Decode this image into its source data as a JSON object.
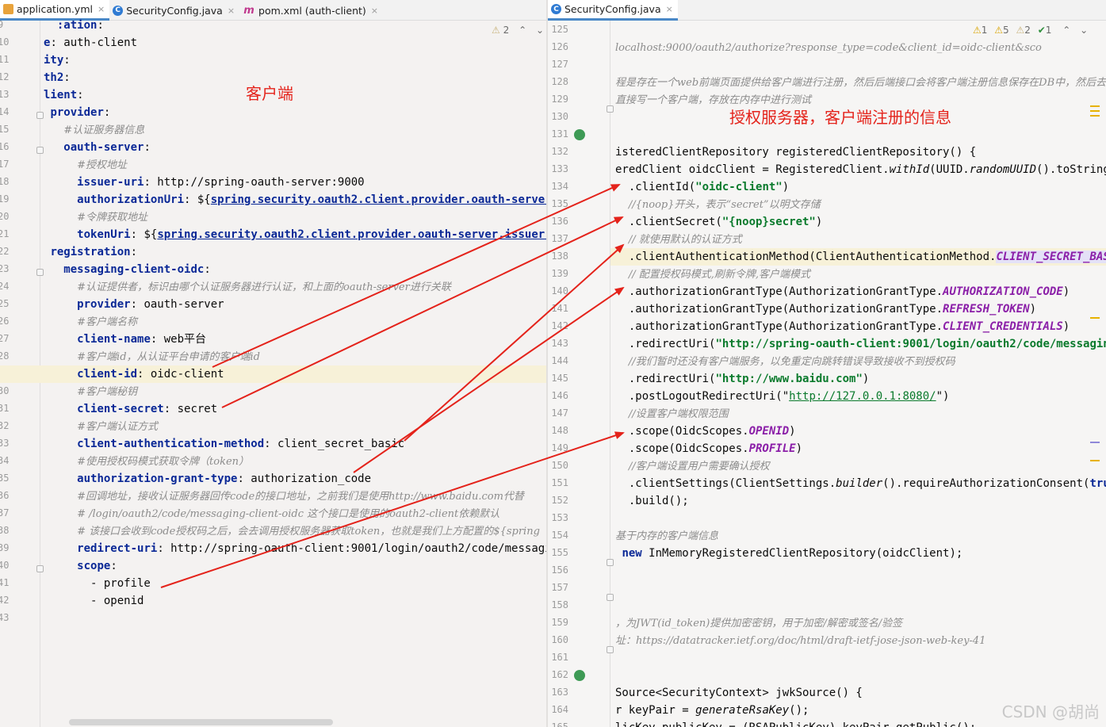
{
  "left_tabs": [
    {
      "label": "application.yml",
      "icon": "yml-file-icon"
    },
    {
      "label": "SecurityConfig.java",
      "icon": "java-class-icon"
    },
    {
      "label": "pom.xml (auth-client)",
      "icon": "maven-icon"
    }
  ],
  "right_tabs": [
    {
      "label": "SecurityConfig.java",
      "icon": "java-class-icon"
    }
  ],
  "tab_close_glyph": "×",
  "left_inspection": {
    "warnings": "2"
  },
  "right_inspection": {
    "warn1": "1",
    "warn2": "5",
    "warn3": "2",
    "ok": "1"
  },
  "annotations": {
    "client_label": "客户端",
    "server_label": "授权服务器，客户端注册的信息"
  },
  "watermark": "CSDN @胡尚",
  "arrow_color": "#e4231b",
  "left_lines": [
    {
      "n": "9",
      "parts": [
        [
          "",
          "  "
        ],
        [
          "k",
          ":ation"
        ],
        [
          "",
          ":"
        ]
      ]
    },
    {
      "n": "10",
      "parts": [
        [
          "k",
          "e"
        ],
        [
          "",
          ": auth-client"
        ]
      ]
    },
    {
      "n": "11",
      "parts": [
        [
          "k",
          "ity"
        ],
        [
          "",
          ":"
        ]
      ]
    },
    {
      "n": "12",
      "parts": [
        [
          "k",
          "th2"
        ],
        [
          "",
          ":"
        ]
      ]
    },
    {
      "n": "13",
      "parts": [
        [
          "k",
          "lient"
        ],
        [
          "",
          ":"
        ]
      ]
    },
    {
      "n": "14",
      "parts": [
        [
          "",
          " "
        ],
        [
          "k",
          "provider"
        ],
        [
          "",
          ":"
        ]
      ]
    },
    {
      "n": "15",
      "parts": [
        [
          "",
          "   "
        ],
        [
          "c",
          "#认证服务器信息"
        ]
      ]
    },
    {
      "n": "16",
      "parts": [
        [
          "",
          "   "
        ],
        [
          "k",
          "oauth-server"
        ],
        [
          "",
          ":"
        ]
      ]
    },
    {
      "n": "17",
      "parts": [
        [
          "",
          "     "
        ],
        [
          "c",
          "#授权地址"
        ]
      ]
    },
    {
      "n": "18",
      "parts": [
        [
          "",
          "     "
        ],
        [
          "k",
          "issuer-uri"
        ],
        [
          "",
          ": http://spring-oauth-server:9000"
        ]
      ]
    },
    {
      "n": "19",
      "parts": [
        [
          "",
          "     "
        ],
        [
          "k",
          "authorizationUri"
        ],
        [
          "",
          ": ${"
        ],
        [
          "ref",
          "spring.security.oauth2.client.provider.oauth-server.iss"
        ]
      ]
    },
    {
      "n": "20",
      "parts": [
        [
          "",
          "     "
        ],
        [
          "c",
          "#令牌获取地址"
        ]
      ]
    },
    {
      "n": "21",
      "parts": [
        [
          "",
          "     "
        ],
        [
          "k",
          "tokenUri"
        ],
        [
          "",
          ": ${"
        ],
        [
          "ref",
          "spring.security.oauth2.client.provider.oauth-server.issuer-uri"
        ],
        [
          "",
          "}"
        ]
      ]
    },
    {
      "n": "22",
      "parts": [
        [
          "",
          " "
        ],
        [
          "k",
          "registration"
        ],
        [
          "",
          ":"
        ]
      ]
    },
    {
      "n": "23",
      "parts": [
        [
          "",
          "   "
        ],
        [
          "k",
          "messaging-client-oidc"
        ],
        [
          "",
          ":"
        ]
      ]
    },
    {
      "n": "24",
      "parts": [
        [
          "",
          "     "
        ],
        [
          "c",
          "#认证提供者，标识由哪个认证服务器进行认证，和上面的oauth-server进行关联"
        ]
      ]
    },
    {
      "n": "25",
      "parts": [
        [
          "",
          "     "
        ],
        [
          "k",
          "provider"
        ],
        [
          "",
          ": oauth-server"
        ]
      ]
    },
    {
      "n": "26",
      "parts": [
        [
          "",
          "     "
        ],
        [
          "c",
          "#客户端名称"
        ]
      ]
    },
    {
      "n": "27",
      "parts": [
        [
          "",
          "     "
        ],
        [
          "k",
          "client-name"
        ],
        [
          "",
          ": web平台"
        ]
      ]
    },
    {
      "n": "28",
      "parts": [
        [
          "",
          "     "
        ],
        [
          "c",
          "#客户端id，从认证平台申请的客户端id"
        ]
      ]
    },
    {
      "n": "29",
      "parts": [
        [
          "",
          "     "
        ],
        [
          "k",
          "client-id"
        ],
        [
          "",
          ": oidc-client"
        ]
      ],
      "highlight": true
    },
    {
      "n": "30",
      "parts": [
        [
          "",
          "     "
        ],
        [
          "c",
          "#客户端秘钥"
        ]
      ]
    },
    {
      "n": "31",
      "parts": [
        [
          "",
          "     "
        ],
        [
          "k",
          "client-secret"
        ],
        [
          "",
          ": secret"
        ]
      ]
    },
    {
      "n": "32",
      "parts": [
        [
          "",
          "     "
        ],
        [
          "c",
          "#客户端认证方式"
        ]
      ]
    },
    {
      "n": "33",
      "parts": [
        [
          "",
          "     "
        ],
        [
          "k",
          "client-authentication-method"
        ],
        [
          "",
          ": client_secret_basic"
        ]
      ]
    },
    {
      "n": "34",
      "parts": [
        [
          "",
          "     "
        ],
        [
          "c",
          "#使用授权码模式获取令牌（token）"
        ]
      ]
    },
    {
      "n": "35",
      "parts": [
        [
          "",
          "     "
        ],
        [
          "k",
          "authorization-grant-type"
        ],
        [
          "",
          ": authorization_code"
        ]
      ]
    },
    {
      "n": "36",
      "parts": [
        [
          "",
          "     "
        ],
        [
          "c",
          "#回调地址，接收认证服务器回传code的接口地址，之前我们是使用http://www.baidu.com代替"
        ]
      ]
    },
    {
      "n": "37",
      "parts": [
        [
          "",
          "     "
        ],
        [
          "c",
          "# /login/oauth2/code/messaging-client-oidc 这个接口是使用的oauth2-client依赖默认"
        ]
      ]
    },
    {
      "n": "38",
      "parts": [
        [
          "",
          "     "
        ],
        [
          "c",
          "# 该接口会收到code授权码之后，会去调用授权服务器获取token，也就是我们上方配置的${spring"
        ]
      ]
    },
    {
      "n": "39",
      "parts": [
        [
          "",
          "     "
        ],
        [
          "k",
          "redirect-uri"
        ],
        [
          "",
          ": http://spring-oauth-client:9001/login/oauth2/code/messaging-c"
        ]
      ]
    },
    {
      "n": "40",
      "parts": [
        [
          "",
          "     "
        ],
        [
          "k",
          "scope"
        ],
        [
          "",
          ":"
        ]
      ]
    },
    {
      "n": "41",
      "parts": [
        [
          "",
          "       - profile"
        ]
      ]
    },
    {
      "n": "42",
      "parts": [
        [
          "",
          "       - openid"
        ]
      ]
    },
    {
      "n": "43",
      "parts": []
    }
  ],
  "right_lines": [
    {
      "n": "125",
      "parts": [
        [
          "c",
          "   "
        ]
      ]
    },
    {
      "n": "126",
      "parts": [
        [
          "c",
          "localhost:9000/oauth2/authorize?response_type=code&client_id=oidc-client&sco"
        ]
      ]
    },
    {
      "n": "127",
      "parts": []
    },
    {
      "n": "128",
      "parts": [
        [
          "c",
          "程是存在一个web前端页面提供给客户端进行注册，然后后端接口会将客户端注册信息保存在DB中，然后去"
        ]
      ]
    },
    {
      "n": "129",
      "parts": [
        [
          "c",
          "直接写一个客户端，存放在内存中进行测试"
        ]
      ]
    },
    {
      "n": "130",
      "parts": []
    },
    {
      "n": "131",
      "parts": [],
      "bean": true
    },
    {
      "n": "132",
      "parts": [
        [
          "",
          "isteredClientRepository registeredClientRepository() {"
        ]
      ]
    },
    {
      "n": "133",
      "parts": [
        [
          "",
          "eredClient oidcClient = RegisteredClient."
        ],
        [
          "it",
          "withId"
        ],
        [
          "",
          "(UUID."
        ],
        [
          "it",
          "randomUUID"
        ],
        [
          "",
          "().toString())"
        ]
      ]
    },
    {
      "n": "134",
      "parts": [
        [
          "",
          "  .clientId("
        ],
        [
          "s",
          "\"oidc-client\""
        ],
        [
          "",
          ")"
        ]
      ]
    },
    {
      "n": "135",
      "parts": [
        [
          "",
          "  "
        ],
        [
          "c",
          "//{noop}开头，表示“secret”以明文存储"
        ]
      ]
    },
    {
      "n": "136",
      "parts": [
        [
          "",
          "  .clientSecret("
        ],
        [
          "s",
          "\"{noop}secret\""
        ],
        [
          "",
          ")"
        ]
      ]
    },
    {
      "n": "137",
      "parts": [
        [
          "",
          "  "
        ],
        [
          "c",
          "// 就使用默认的认证方式"
        ]
      ]
    },
    {
      "n": "138",
      "parts": [
        [
          "",
          "  .clientAuthenticationMethod(ClientAuthenticationMethod."
        ],
        [
          "enum enum-hl",
          "CLIENT_SECRET_BASIC"
        ],
        [
          "",
          ")"
        ]
      ],
      "highlight": true
    },
    {
      "n": "139",
      "parts": [
        [
          "",
          "  "
        ],
        [
          "c",
          "// 配置授权码模式,刷新令牌,客户端模式"
        ]
      ]
    },
    {
      "n": "140",
      "parts": [
        [
          "",
          "  .authorizationGrantType(AuthorizationGrantType."
        ],
        [
          "enum",
          "AUTHORIZATION_CODE"
        ],
        [
          "",
          ")"
        ]
      ]
    },
    {
      "n": "141",
      "parts": [
        [
          "",
          "  .authorizationGrantType(AuthorizationGrantType."
        ],
        [
          "enum",
          "REFRESH_TOKEN"
        ],
        [
          "",
          ")"
        ]
      ]
    },
    {
      "n": "142",
      "parts": [
        [
          "",
          "  .authorizationGrantType(AuthorizationGrantType."
        ],
        [
          "enum",
          "CLIENT_CREDENTIALS"
        ],
        [
          "",
          ")"
        ]
      ]
    },
    {
      "n": "143",
      "parts": [
        [
          "",
          "  .redirectUri("
        ],
        [
          "s",
          "\"http://spring-oauth-client:9001/login/oauth2/code/messaging-c"
        ]
      ]
    },
    {
      "n": "144",
      "parts": [
        [
          "",
          "  "
        ],
        [
          "c",
          "//我们暂时还没有客户端服务，以免重定向跳转错误导致接收不到授权码"
        ]
      ]
    },
    {
      "n": "145",
      "parts": [
        [
          "",
          "  .redirectUri("
        ],
        [
          "s",
          "\"http://www.baidu.com\""
        ],
        [
          "",
          ")"
        ]
      ]
    },
    {
      "n": "146",
      "parts": [
        [
          "",
          "  .postLogoutRedirectUri(\""
        ],
        [
          "u",
          "http://127.0.0.1:8080/"
        ],
        [
          "",
          "\")"
        ]
      ]
    },
    {
      "n": "147",
      "parts": [
        [
          "",
          "  "
        ],
        [
          "c",
          "//设置客户端权限范围"
        ]
      ]
    },
    {
      "n": "148",
      "parts": [
        [
          "",
          "  .scope(OidcScopes."
        ],
        [
          "enum",
          "OPENID"
        ],
        [
          "",
          ")"
        ]
      ]
    },
    {
      "n": "149",
      "parts": [
        [
          "",
          "  .scope(OidcScopes."
        ],
        [
          "enum",
          "PROFILE"
        ],
        [
          "",
          ")"
        ]
      ]
    },
    {
      "n": "150",
      "parts": [
        [
          "",
          "  "
        ],
        [
          "c",
          "//客户端设置用户需要确认授权"
        ]
      ]
    },
    {
      "n": "151",
      "parts": [
        [
          "",
          "  .clientSettings(ClientSettings."
        ],
        [
          "it",
          "builder"
        ],
        [
          "",
          "().requireAuthorizationConsent("
        ],
        [
          "kw",
          "true"
        ],
        [
          "",
          ")."
        ]
      ]
    },
    {
      "n": "152",
      "parts": [
        [
          "",
          "  .build();"
        ]
      ]
    },
    {
      "n": "153",
      "parts": []
    },
    {
      "n": "154",
      "parts": [
        [
          "c",
          "基于内存的客户端信息"
        ]
      ]
    },
    {
      "n": "155",
      "parts": [
        [
          "",
          " "
        ],
        [
          "kw",
          "new"
        ],
        [
          "",
          " InMemoryRegisteredClientRepository(oidcClient);"
        ]
      ]
    },
    {
      "n": "156",
      "parts": []
    },
    {
      "n": "157",
      "parts": []
    },
    {
      "n": "158",
      "parts": []
    },
    {
      "n": "159",
      "parts": [
        [
          "c",
          "，为JWT(id_token)提供加密密钥，用于加密/解密或签名/验签"
        ]
      ]
    },
    {
      "n": "160",
      "parts": [
        [
          "c",
          "址：https://datatracker.ietf.org/doc/html/draft-ietf-jose-json-web-key-41"
        ]
      ]
    },
    {
      "n": "161",
      "parts": []
    },
    {
      "n": "162",
      "parts": [],
      "bean": true
    },
    {
      "n": "163",
      "parts": [
        [
          "",
          "Source<SecurityContext> jwkSource() {"
        ]
      ]
    },
    {
      "n": "164",
      "parts": [
        [
          "",
          "r keyPair = "
        ],
        [
          "it",
          "generateRsaKey"
        ],
        [
          "",
          "();"
        ]
      ]
    },
    {
      "n": "165",
      "parts": [
        [
          "",
          "licKey publicKey = (RSAPublicKey) keyPair.getPublic();"
        ]
      ]
    }
  ]
}
